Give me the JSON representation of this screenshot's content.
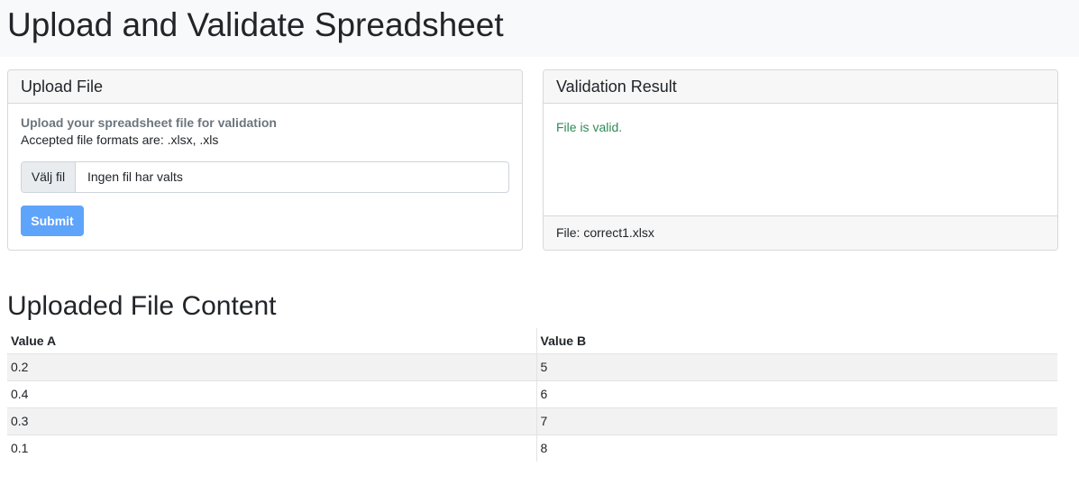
{
  "header": {
    "title": "Upload and Validate Spreadsheet"
  },
  "upload_card": {
    "title": "Upload File",
    "instruction": "Upload your spreadsheet file for validation",
    "accepted_formats": "Accepted file formats are: .xlsx, .xls",
    "file_button_label": "Välj fil",
    "file_status": "Ingen fil har valts",
    "submit_label": "Submit",
    "submit_color": "#5fa4fb"
  },
  "result_card": {
    "title": "Validation Result",
    "message": "File is valid.",
    "message_color": "#2e8b57",
    "footer": "File: correct1.xlsx"
  },
  "content": {
    "title": "Uploaded File Content",
    "columns": [
      "Value A",
      "Value B"
    ],
    "rows": [
      [
        "0.2",
        "5"
      ],
      [
        "0.4",
        "6"
      ],
      [
        "0.3",
        "7"
      ],
      [
        "0.1",
        "8"
      ]
    ]
  }
}
